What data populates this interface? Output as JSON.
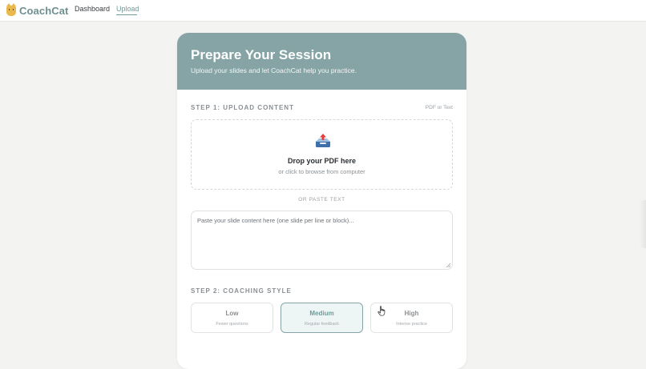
{
  "app": {
    "brand_name": "CoachCat",
    "brand_icon": "cat-face-icon"
  },
  "nav": {
    "items": [
      {
        "label": "Dashboard",
        "active": false
      },
      {
        "label": "Upload",
        "active": true
      }
    ]
  },
  "header": {
    "title": "Prepare Your Session",
    "subtitle": "Upload your slides and let CoachCat help you practice."
  },
  "step1": {
    "label": "STEP 1: UPLOAD CONTENT",
    "hint": "PDF or Text",
    "dropzone": {
      "icon": "inbox-upload-icon",
      "title": "Drop your PDF here",
      "subtitle": "or click to browse from computer"
    },
    "divider": "OR PASTE TEXT",
    "textarea": {
      "placeholder": "Paste your slide content here (one slide per line or block)...",
      "value": ""
    }
  },
  "step2": {
    "label": "STEP 2: COACHING STYLE",
    "options": [
      {
        "label": "Low",
        "description": "Fewer questions",
        "selected": false
      },
      {
        "label": "Medium",
        "description": "Regular feedback",
        "selected": true
      },
      {
        "label": "High",
        "description": "Intense practice",
        "selected": false
      }
    ]
  },
  "colors": {
    "accent": "#86a4a6",
    "brand_text": "#6f8f8f",
    "selected_bg": "#eef6f5",
    "page_bg": "#f3f3f1"
  }
}
